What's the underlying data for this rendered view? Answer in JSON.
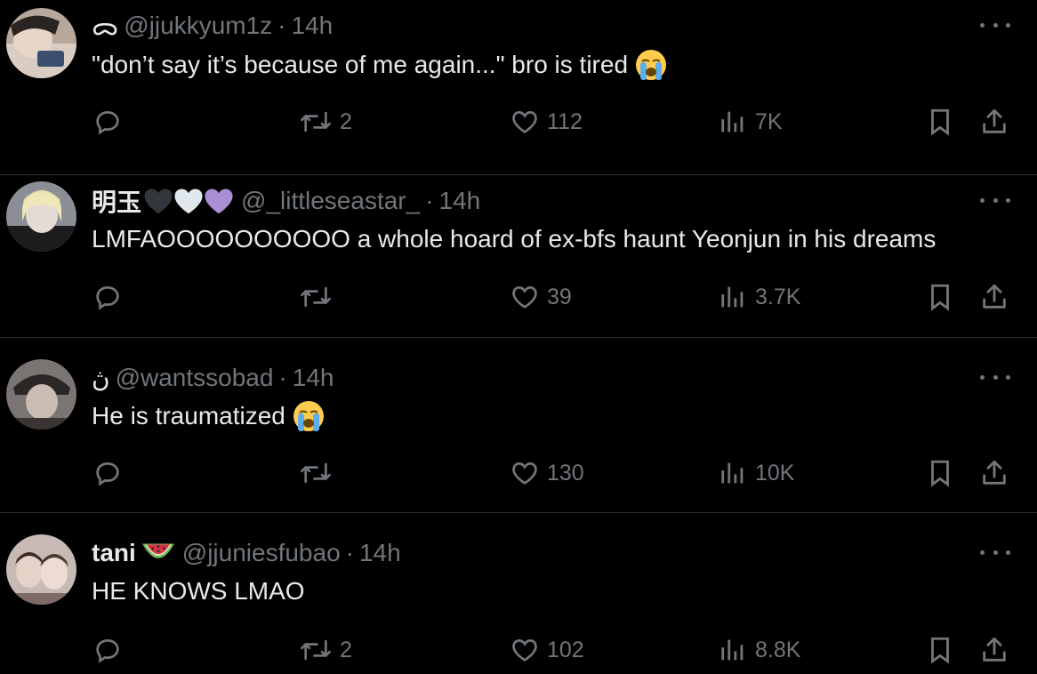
{
  "tweets": [
    {
      "name": "",
      "name_prefix_glyph": "ᯅ",
      "handle": "@jjukkyum1z",
      "dot": "·",
      "time": "14h",
      "text": "\"don’t say it’s because of me again...\" bro is tired",
      "text_emoji": "loudly-crying-face-emoji",
      "retweets": "2",
      "likes": "112",
      "views": "7K"
    },
    {
      "name": "明玉",
      "name_emoji": [
        "black-heart-emoji",
        "white-heart-emoji",
        "purple-heart-emoji"
      ],
      "handle": "@_littleseastar_",
      "dot": "·",
      "time": "14h",
      "text": "LMFAOOOOOOOOOO a whole hoard of ex-bfs haunt Yeonjun in his dreams",
      "retweets": "",
      "likes": "39",
      "views": "3.7K"
    },
    {
      "name": "",
      "name_prefix_glyph": "ڽ",
      "handle": "@wantssobad",
      "dot": "·",
      "time": "14h",
      "text": "He is traumatized",
      "text_emoji": "loudly-crying-face-emoji",
      "retweets": "",
      "likes": "130",
      "views": "10K"
    },
    {
      "name": "tani",
      "name_emoji": [
        "watermelon-emoji"
      ],
      "handle": "@jjuniesfubao",
      "dot": "·",
      "time": "14h",
      "text": "HE KNOWS LMAO",
      "retweets": "2",
      "likes": "102",
      "views": "8.8K"
    }
  ],
  "colors": {
    "background": "#000000",
    "text": "#e7e9ea",
    "secondary": "#71767b",
    "divider": "#2f3336"
  }
}
